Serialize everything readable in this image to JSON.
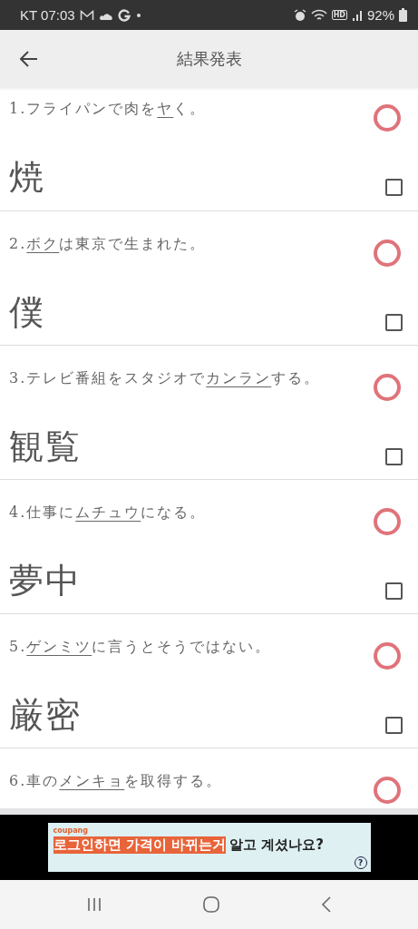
{
  "status_bar": {
    "carrier_time": "KT 07:03",
    "hd_badge": "HD",
    "battery": "92%"
  },
  "app_bar": {
    "title": "結果発表"
  },
  "questions": [
    {
      "number": "1.",
      "before": "フライパンで肉を",
      "target": "ヤ",
      "after": "く。",
      "answer": "焼",
      "correct": true,
      "checked": false
    },
    {
      "number": "2.",
      "target": "ボク",
      "after": "は東京で生まれた。",
      "answer": "僕",
      "correct": true,
      "checked": false
    },
    {
      "number": "3.",
      "before": "テレビ番組をスタジオで",
      "target": "カンラン",
      "after": "する。",
      "answer": "観覧",
      "correct": true,
      "checked": false
    },
    {
      "number": "4.",
      "before": "仕事に",
      "target": "ムチュウ",
      "after": "になる。",
      "answer": "夢中",
      "correct": true,
      "checked": false
    },
    {
      "number": "5.",
      "target": "ゲンミツ",
      "after": "に言うとそうではない。",
      "answer": "厳密",
      "correct": true,
      "checked": false
    },
    {
      "number": "6.",
      "before": "車の",
      "target": "メンキョ",
      "after": "を取得する。",
      "correct": true
    }
  ],
  "ad": {
    "brand": "coupang",
    "highlight": "로그인하면 가격이 바뀌는거",
    "rest": "알고 계셨나요?",
    "help": "?"
  }
}
